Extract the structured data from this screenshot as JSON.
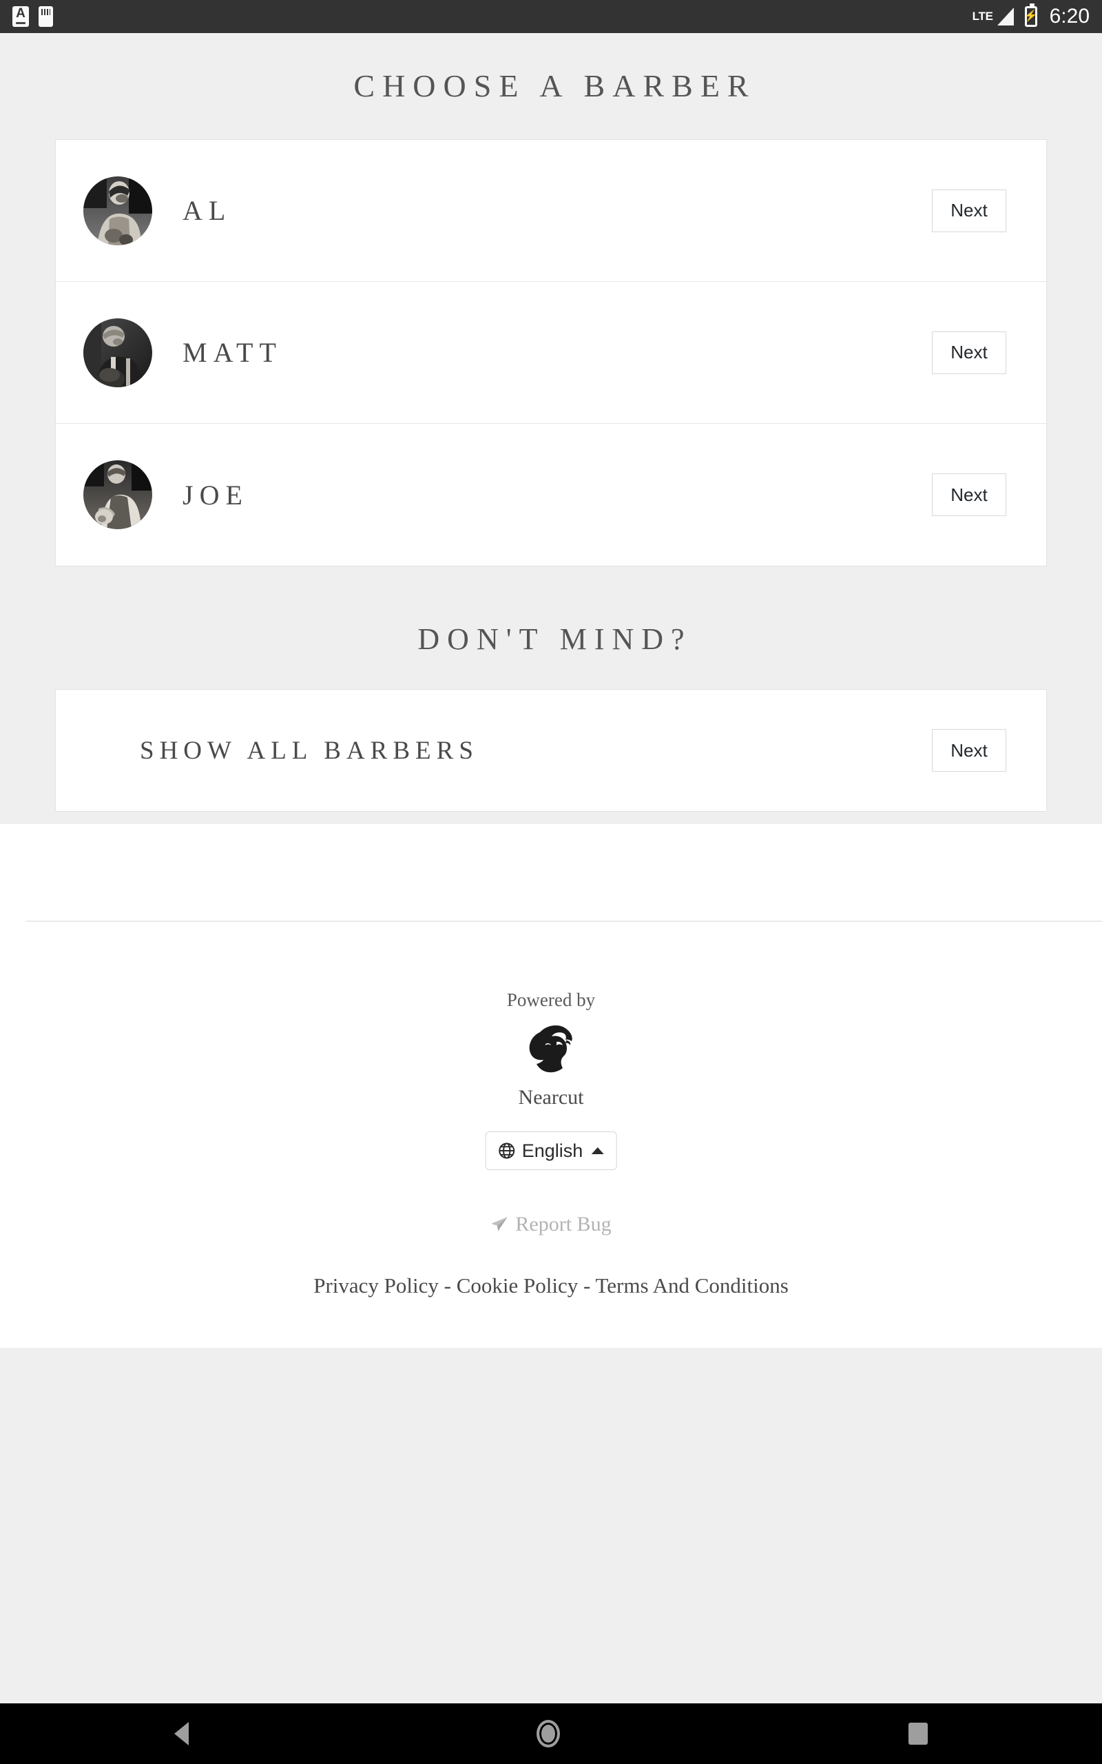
{
  "status_bar": {
    "icons_left": [
      "font-size-icon",
      "sd-card-icon"
    ],
    "network": "LTE",
    "battery_state": "charging",
    "time": "6:20"
  },
  "page": {
    "title": "CHOOSE A BARBER",
    "subtitle": "DON'T MIND?"
  },
  "barbers": [
    {
      "name": "AL",
      "action_label": "Next",
      "avatar": "barber-photo-al"
    },
    {
      "name": "MATT",
      "action_label": "Next",
      "avatar": "barber-photo-matt"
    },
    {
      "name": "JOE",
      "action_label": "Next",
      "avatar": "barber-photo-joe"
    }
  ],
  "show_all": {
    "label": "SHOW ALL BARBERS",
    "action_label": "Next"
  },
  "footer": {
    "powered_by": "Powered by",
    "brand": "Nearcut",
    "language": "English",
    "report_bug": "Report Bug",
    "legal": {
      "privacy": "Privacy Policy",
      "sep1": " - ",
      "cookie": "Cookie Policy",
      "sep2": " - ",
      "terms": "Terms And Conditions"
    }
  },
  "colors": {
    "page_background": "#efefef",
    "card_background": "#ffffff",
    "card_border": "#e2e2e2",
    "heading_text": "#555555",
    "name_text": "#4a4a4a",
    "muted_text": "#b3b3b3",
    "status_bar": "#333333",
    "nav_bar": "#000000"
  },
  "nav_bar": {
    "back": "back-icon",
    "home": "home-icon",
    "recents": "recents-icon"
  }
}
